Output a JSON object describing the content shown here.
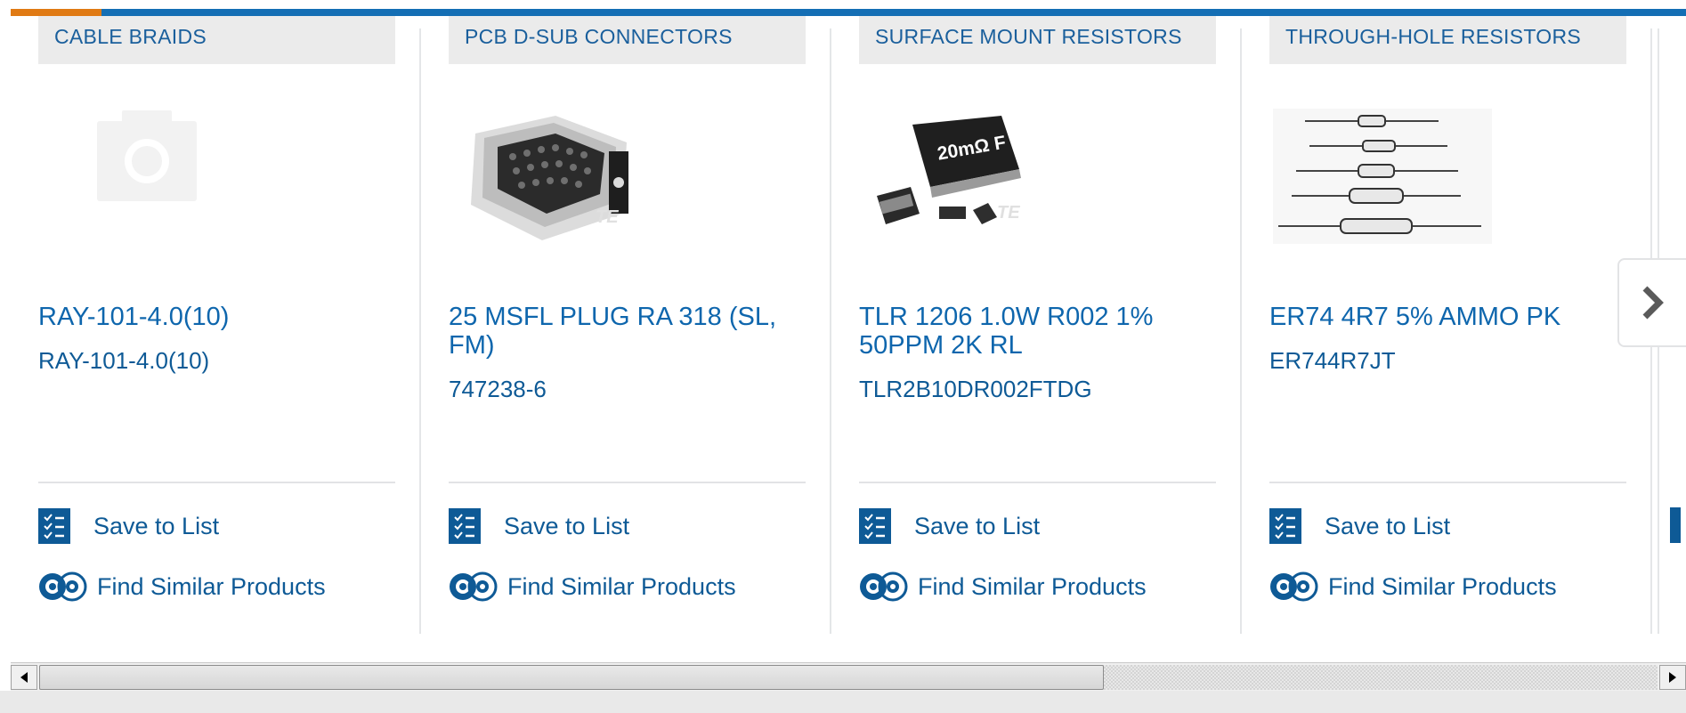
{
  "colors": {
    "accent_orange": "#e07a14",
    "brand_blue": "#146eb4",
    "link_blue": "#0e66ad",
    "tab_bg": "#ebebeb"
  },
  "products": [
    {
      "category": "CABLE BRAIDS",
      "image": "placeholder-camera",
      "name": "RAY-101-4.0(10)",
      "part_number": "RAY-101-4.0(10)",
      "save_label": "Save to List",
      "similar_label": "Find Similar Products"
    },
    {
      "category": "PCB D-SUB CONNECTORS",
      "image": "d-sub-connector-photo",
      "name": "25 MSFL PLUG RA 318 (SL, FM)",
      "part_number": "747238-6",
      "save_label": "Save to List",
      "similar_label": "Find Similar Products"
    },
    {
      "category": "SURFACE MOUNT RESISTORS",
      "image": "smd-resistor-photo",
      "image_text": "20mΩ F",
      "name": "TLR 1206 1.0W R002 1% 50PPM 2K RL",
      "part_number": "TLR2B10DR002FTDG",
      "save_label": "Save to List",
      "similar_label": "Find Similar Products"
    },
    {
      "category": "THROUGH-HOLE RESISTORS",
      "image": "axial-resistors-photo",
      "name": "ER74 4R7 5% AMMO PK",
      "part_number": "ER744R7JT",
      "save_label": "Save to List",
      "similar_label": "Find Similar Products"
    }
  ],
  "next_icon": "chevron-right-icon",
  "scrollbar": {
    "position_fraction": 0.0,
    "visible_fraction": 0.66
  }
}
